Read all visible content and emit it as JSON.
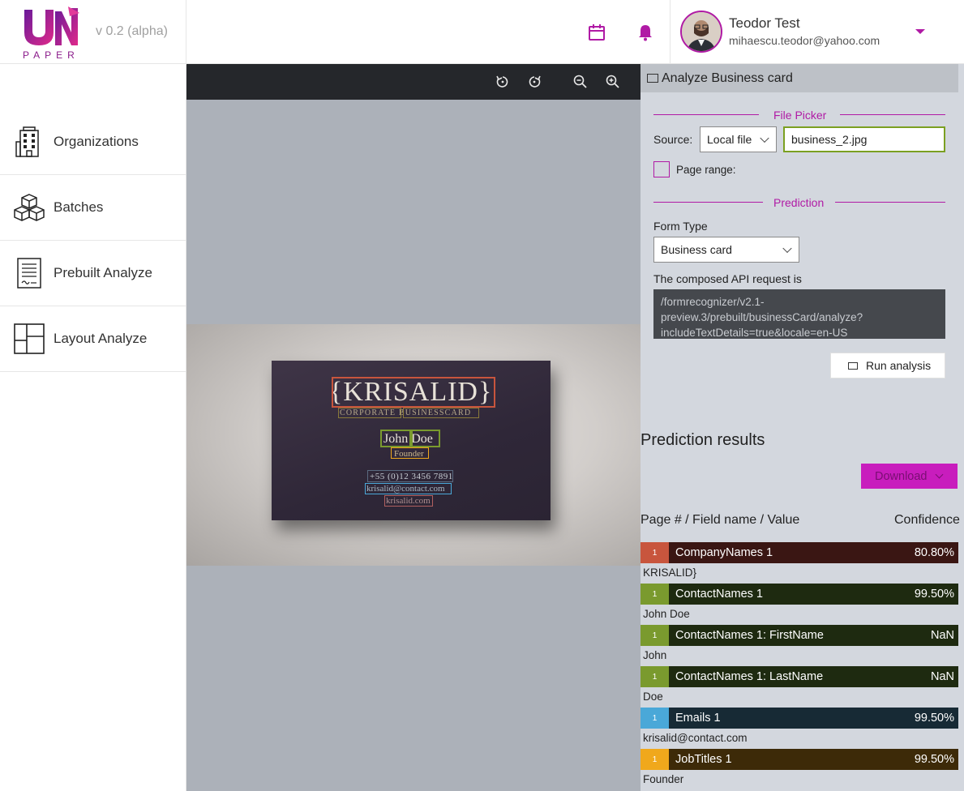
{
  "header": {
    "logo_text": "PAPER",
    "version": "v 0.2 (alpha)",
    "user_name": "Teodor Test",
    "user_email": "mihaescu.teodor@yahoo.com"
  },
  "sidebar": {
    "items": [
      {
        "label": "Organizations",
        "icon": "building-icon"
      },
      {
        "label": "Batches",
        "icon": "boxes-icon"
      },
      {
        "label": "Prebuilt Analyze",
        "icon": "document-icon"
      },
      {
        "label": "Layout Analyze",
        "icon": "layout-icon"
      }
    ]
  },
  "card": {
    "company": "{KRISALID}",
    "tagline": "CORPORATE BUSINESSCARD",
    "name": "John Doe",
    "title": "Founder",
    "phone": "+55 (0)12 3456 7891",
    "email": "krisalid@contact.com",
    "web": "krisalid.com"
  },
  "panel": {
    "title": "Analyze Business card",
    "file_picker_label": "File Picker",
    "source_label": "Source:",
    "source_value": "Local file",
    "file_name": "business_2.jpg",
    "page_range_label": "Page range:",
    "prediction_label": "Prediction",
    "form_type_label": "Form Type",
    "form_type_value": "Business card",
    "api_label": "The composed API request is",
    "api_request": "/formrecognizer/v2.1-preview.3/prebuilt/businessCard/analyze?includeTextDetails=true&locale=en-US",
    "run_label": "Run analysis",
    "results_title": "Prediction results",
    "download_label": "Download",
    "col_field": "Page # / Field name / Value",
    "col_conf": "Confidence"
  },
  "results": [
    {
      "page": "1",
      "name": "CompanyNames 1",
      "confidence": "80.80%",
      "value": "KRISALID}",
      "accent": "#c8553d",
      "bar": "#3a1613"
    },
    {
      "page": "1",
      "name": "ContactNames 1",
      "confidence": "99.50%",
      "value": "John Doe",
      "accent": "#7a9a2e",
      "bar": "#1e2a10"
    },
    {
      "page": "1",
      "name": "ContactNames 1: FirstName",
      "confidence": "NaN",
      "value": "John",
      "accent": "#7a9a2e",
      "bar": "#1e2a10"
    },
    {
      "page": "1",
      "name": "ContactNames 1: LastName",
      "confidence": "NaN",
      "value": "Doe",
      "accent": "#7a9a2e",
      "bar": "#1e2a10"
    },
    {
      "page": "1",
      "name": "Emails 1",
      "confidence": "99.50%",
      "value": "krisalid@contact.com",
      "accent": "#4aa8d8",
      "bar": "#172a35"
    },
    {
      "page": "1",
      "name": "JobTitles 1",
      "confidence": "99.50%",
      "value": "Founder",
      "accent": "#f0a81c",
      "bar": "#3d2a08"
    }
  ],
  "colors": {
    "brand": "#b01aa5",
    "file_input_border": "#7ba021",
    "download_bg": "#c81dbd"
  }
}
